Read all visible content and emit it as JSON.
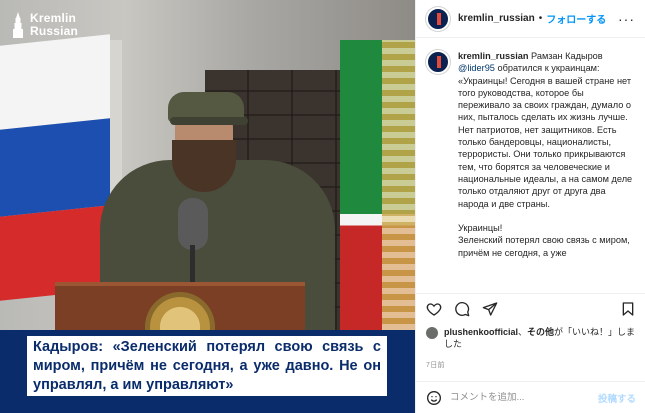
{
  "media": {
    "logo_line1": "Kremlin",
    "logo_line2": "Russian",
    "caption": "Кадыров: «Зеленский потерял свою связь с миром, причём не сегодня, а уже давно. Не он управлял, а им управляют»",
    "colors": {
      "band": "#0a2c6b",
      "caption_text": "#0a2c6b"
    }
  },
  "header": {
    "username": "kremlin_russian",
    "separator": "•",
    "follow_label": "フォローする",
    "more_icon": "more-horizontal-icon"
  },
  "post": {
    "username": "kremlin_russian",
    "author_name": "Рамзан Кадыров",
    "mention": "@lider95",
    "lead": "обратился к украинцам:",
    "paragraph1": "«Украинцы! Сегодня в вашей стране нет того руководства, которое бы переживало за своих граждан, думало о них, пыталось сделать их жизнь лучше. Нет патриотов, нет защитников. Есть только бандеровцы, националисты, террористы. Они только прикрываются тем, что борятся за человеческие и национальные идеалы, а на самом деле только отдаляют друг от друга два народа и две страны.",
    "paragraph2": "Украинцы!",
    "paragraph3": "Зеленский потерял свою связь с миром, причём не сегодня, а уже"
  },
  "actions": {
    "icons": [
      "heart-icon",
      "comment-icon",
      "share-icon",
      "bookmark-icon"
    ]
  },
  "likes": {
    "user": "plushenkoofficial",
    "separator": "、",
    "others": "その他",
    "suffix": "が「いいね！」しました"
  },
  "time": "7日前",
  "comment_bar": {
    "emoji_icon": "emoji-icon",
    "placeholder": "コメントを追加...",
    "post_label": "投稿する"
  },
  "colors": {
    "accent": "#0095f6",
    "post_disabled": "#b3dbff",
    "mention": "#00376b",
    "muted": "#8e8e8e"
  }
}
